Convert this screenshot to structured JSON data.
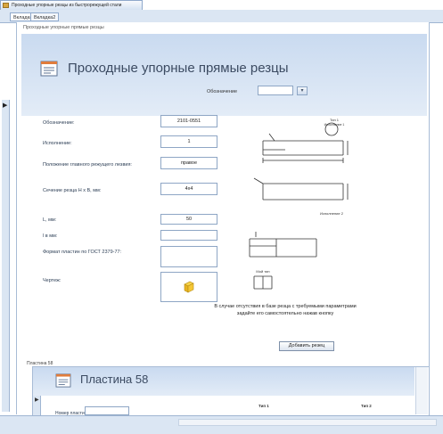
{
  "document_tab": {
    "title": "Проходные упорные резцы из быстрорежущей стали"
  },
  "form_tabs": [
    {
      "label": "Вкладка1",
      "active": true
    },
    {
      "label": "Вкладка2",
      "active": false
    }
  ],
  "form": {
    "caption": "Проходные упорные прямые резцы",
    "title": "Проходные упорные прямые резцы",
    "selector_label": "Обозначение",
    "selector_value": "",
    "fields": [
      {
        "label": "Обозначение:",
        "value": "2101-0551"
      },
      {
        "label": "Исполнение:",
        "value": "1"
      },
      {
        "label": "Положение главного режущего лезвия:",
        "value": "правое"
      },
      {
        "label": "Сечение резца H x B, мм:",
        "value": "4x4"
      },
      {
        "label": "L, мм:",
        "value": "50"
      },
      {
        "label": "l в мм:",
        "value": ""
      },
      {
        "label": "Формат пластин по ГОСТ 2379-77:",
        "value": ""
      },
      {
        "label": "Чертеж:",
        "value": ""
      }
    ],
    "drawing_labels": {
      "top_label": "Тип 1",
      "top_sublabel": "Исполнение 1",
      "mid_label": "Исполнение 2",
      "bottom_label": "Мой тип"
    },
    "note": "В случае отсутствия в базе резца с требуемыми параметрами задайте его самостоятельно нажав кнопку",
    "add_button": "Добавить резец"
  },
  "subform": {
    "caption": "Пластина 58",
    "title": "Пластина 58",
    "plate_number_label": "Номер пластины:",
    "plate_number_value": "",
    "view1": "Тип 1",
    "view2": "Тип 2"
  },
  "colors": {
    "header_band": "#c9daf0",
    "border": "#8ea6c5"
  }
}
